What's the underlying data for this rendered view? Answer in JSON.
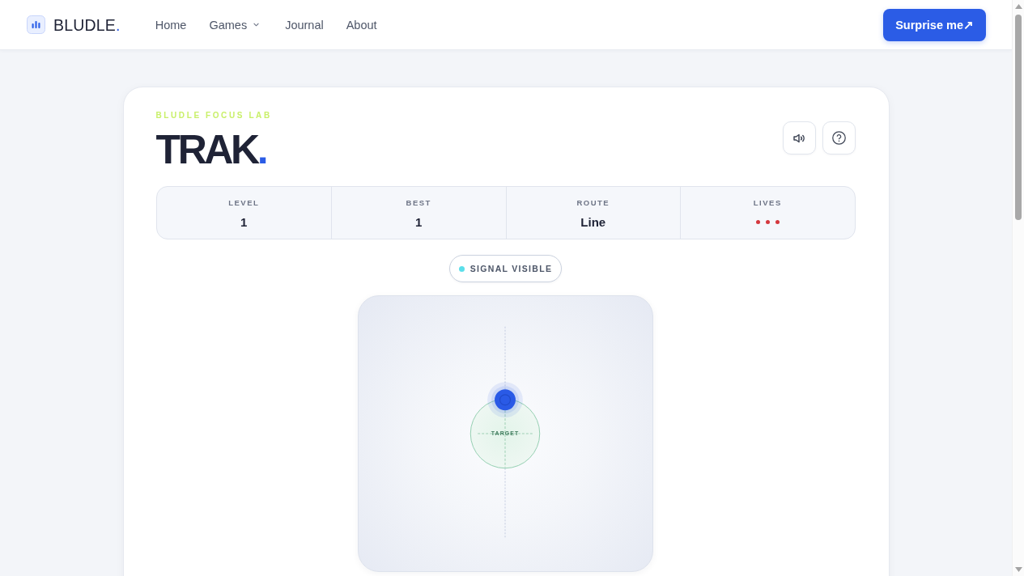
{
  "nav": {
    "brand": "BLUDLE",
    "brand_mark": ".",
    "items": [
      {
        "label": "Home",
        "dropdown": false
      },
      {
        "label": "Games",
        "dropdown": true
      },
      {
        "label": "Journal",
        "dropdown": false
      },
      {
        "label": "About",
        "dropdown": false
      }
    ],
    "action": "Surprise me↗"
  },
  "game": {
    "eyebrow": "BLUDLE FOCUS LAB",
    "title": "TRAK",
    "title_mark": ".",
    "controls": [
      {
        "kind": "sound"
      },
      {
        "kind": "help"
      }
    ],
    "stats": [
      {
        "kind": "value",
        "label": "LEVEL",
        "value": "1"
      },
      {
        "kind": "value",
        "label": "BEST",
        "value": "1"
      },
      {
        "kind": "value",
        "label": "ROUTE",
        "value": "Line"
      },
      {
        "kind": "lives",
        "label": "LIVES",
        "lives": [
          {
            "lost": false
          },
          {
            "lost": false
          },
          {
            "lost": false
          }
        ]
      }
    ],
    "signal": {
      "label": "SIGNAL VISIBLE",
      "visible": true
    },
    "arena": {
      "target_label": "TARGET"
    }
  }
}
